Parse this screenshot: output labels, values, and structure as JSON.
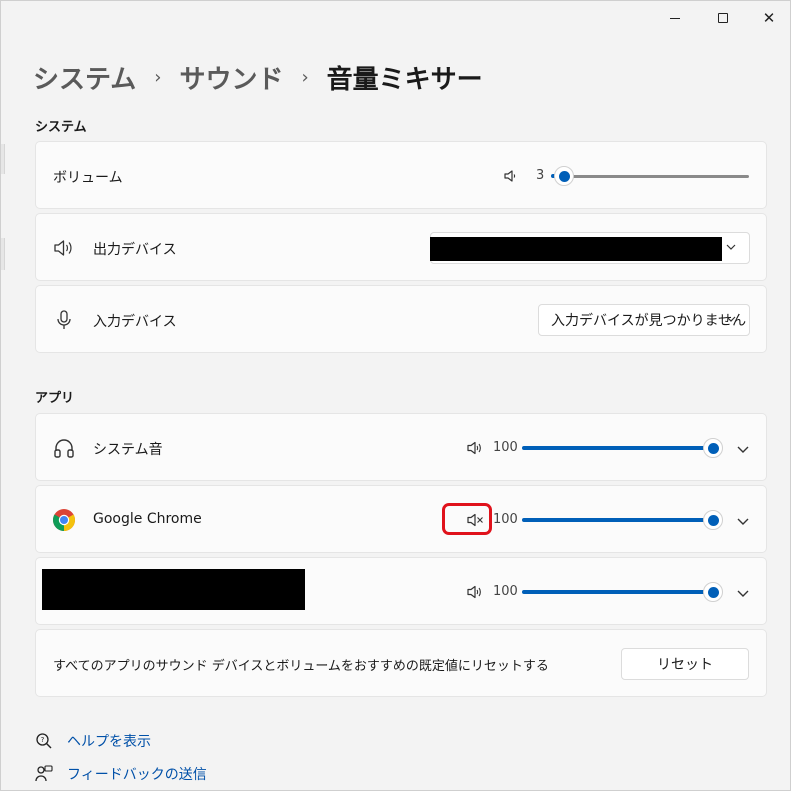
{
  "window": {
    "minimize_label": "—",
    "maximize_label": "☐",
    "close_label": "✕"
  },
  "breadcrumb": {
    "items": [
      "システム",
      "サウンド",
      "音量ミキサー"
    ],
    "separator": "›"
  },
  "system_section": {
    "label": "システム",
    "volume": {
      "label": "ボリューム",
      "value": "3",
      "percent": 3
    },
    "output": {
      "label": "出力デバイス",
      "value": ""
    },
    "input": {
      "label": "入力デバイス",
      "value": "入力デバイスが見つかりません"
    }
  },
  "apps_section": {
    "label": "アプリ",
    "apps": [
      {
        "name": "システム音",
        "volume": "100",
        "muted": false,
        "percent": 100
      },
      {
        "name": "Google Chrome",
        "volume": "100",
        "muted": true,
        "percent": 100
      },
      {
        "name": "",
        "volume": "100",
        "muted": false,
        "percent": 100
      }
    ]
  },
  "reset_card": {
    "text": "すべてのアプリのサウンド デバイスとボリュームをおすすめの既定値にリセットする",
    "button": "リセット"
  },
  "footer": {
    "help": "ヘルプを表示",
    "feedback": "フィードバックの送信"
  },
  "colors": {
    "accent": "#005fb8",
    "highlight": "#e0121b",
    "link": "#0050a8"
  },
  "icons": {
    "speaker": "speaker-icon",
    "microphone": "microphone-icon",
    "headphones": "headphones-icon",
    "chrome": "chrome-icon",
    "muted": "speaker-muted-icon",
    "chevron": "chevron-down-icon",
    "help": "help-icon",
    "feedback": "feedback-icon"
  }
}
